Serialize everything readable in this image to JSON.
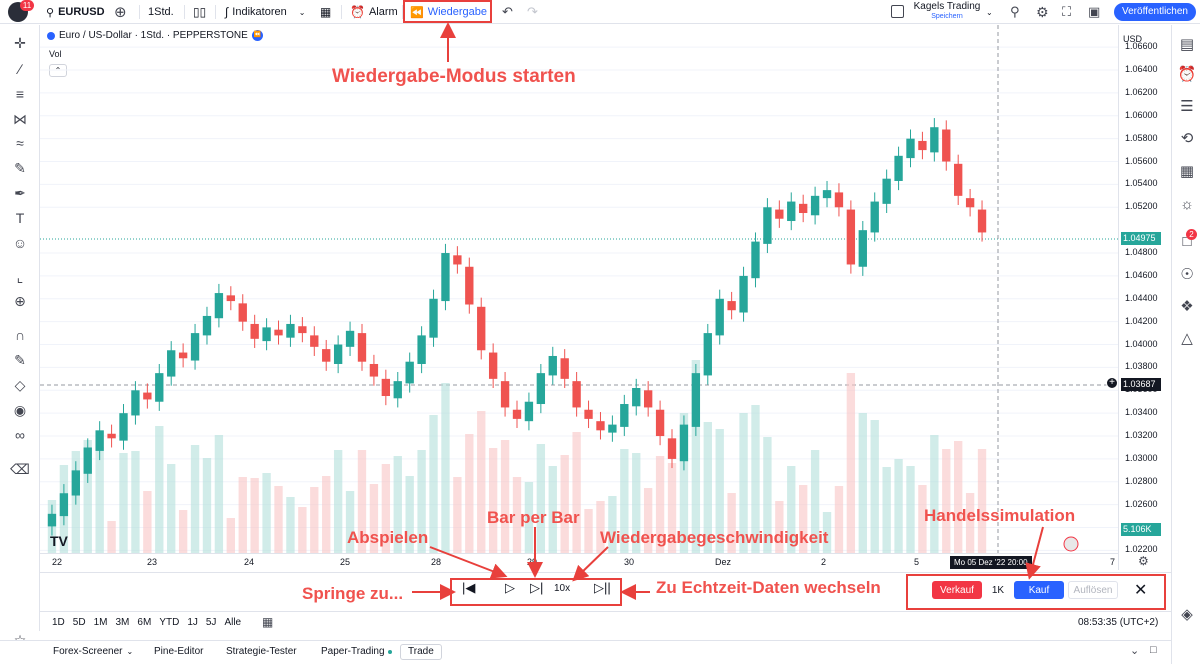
{
  "header": {
    "notification_count": "11",
    "symbol": "EURUSD",
    "interval": "1Std.",
    "indicators_label": "Indikatoren",
    "alarm_label": "Alarm",
    "replay_label": "Wiedergabe",
    "layout_name": "Kagels Trading",
    "layout_sub": "Speichern",
    "publish_label": "Veröffentlichen"
  },
  "legend": {
    "title": "Euro / US-Dollar · 1Std. · PEPPERSTONE",
    "vol_label": "Vol"
  },
  "price_scale": {
    "currency": "USD",
    "labels": [
      "1.06600",
      "1.06400",
      "1.06200",
      "1.06000",
      "1.05800",
      "1.05600",
      "1.05400",
      "1.05200",
      "1.04800",
      "1.04600",
      "1.04400",
      "1.04200",
      "1.04000",
      "1.03800",
      "1.03600",
      "1.03400",
      "1.03200",
      "1.03000",
      "1.02800",
      "1.02600",
      "1.02400",
      "1.02200"
    ],
    "current_price": "1.04975",
    "cursor_price": "1.03687",
    "volume_value": "5.106K"
  },
  "time_axis": {
    "labels": [
      "22",
      "23",
      "24",
      "25",
      "28",
      "29",
      "30",
      "Dez",
      "2",
      "5",
      "7"
    ],
    "cursor_label": "Mo 05 Dez '22   20:00"
  },
  "replay_bar": {
    "speed_label": "10x",
    "sell_label": "Verkauf",
    "qty_label": "1K",
    "buy_label": "Kauf",
    "close_label": "Auflösen"
  },
  "range_bar": {
    "ranges": [
      "1D",
      "5D",
      "1M",
      "3M",
      "6M",
      "YTD",
      "1J",
      "5J",
      "Alle"
    ],
    "clock": "08:53:35 (UTC+2)"
  },
  "bottom_tabs": [
    "Forex-Screener",
    "Pine-Editor",
    "Strategie-Tester",
    "Paper-Trading",
    "Trade"
  ],
  "right_badge": "2",
  "annotations": {
    "replay_start": "Wiedergabe-Modus starten",
    "play": "Abspielen",
    "bar_by_bar": "Bar per Bar",
    "speed": "Wiedergabegeschwindigkeit",
    "jump_to": "Springe zu...",
    "realtime": "Zu Echtzeit-Daten wechseln",
    "trade_sim": "Handelssimulation"
  },
  "colors": {
    "up": "#26a69a",
    "down": "#ef5350",
    "accent": "#2962ff",
    "annotation": "#f0524e"
  },
  "chart_data": {
    "type": "candlestick",
    "title": "Euro / US-Dollar · 1Std. · PEPPERSTONE",
    "ylim": [
      1.0216,
      1.0668
    ],
    "series": [
      {
        "name": "EURUSD",
        "points": [
          [
            1.0241,
            1.0252
          ],
          [
            1.025,
            1.027
          ],
          [
            1.0268,
            1.029
          ],
          [
            1.0287,
            1.031
          ],
          [
            1.0307,
            1.0325
          ],
          [
            1.0322,
            1.0318
          ],
          [
            1.0316,
            1.034
          ],
          [
            1.0338,
            1.036
          ],
          [
            1.0358,
            1.0352
          ],
          [
            1.035,
            1.0375
          ],
          [
            1.0372,
            1.0395
          ],
          [
            1.0393,
            1.0388
          ],
          [
            1.0386,
            1.041
          ],
          [
            1.0408,
            1.0425
          ],
          [
            1.0423,
            1.0445
          ],
          [
            1.0443,
            1.0438
          ],
          [
            1.0436,
            1.042
          ],
          [
            1.0418,
            1.0405
          ],
          [
            1.0403,
            1.0415
          ],
          [
            1.0413,
            1.0408
          ],
          [
            1.0406,
            1.0418
          ],
          [
            1.0416,
            1.041
          ],
          [
            1.0408,
            1.0398
          ],
          [
            1.0396,
            1.0385
          ],
          [
            1.0383,
            1.04
          ],
          [
            1.0398,
            1.0412
          ],
          [
            1.041,
            1.0385
          ],
          [
            1.0383,
            1.0372
          ],
          [
            1.037,
            1.0355
          ],
          [
            1.0353,
            1.0368
          ],
          [
            1.0366,
            1.0385
          ],
          [
            1.0383,
            1.0408
          ],
          [
            1.0406,
            1.044
          ],
          [
            1.0438,
            1.048
          ],
          [
            1.0478,
            1.047
          ],
          [
            1.0468,
            1.0435
          ],
          [
            1.0433,
            1.0395
          ],
          [
            1.0393,
            1.037
          ],
          [
            1.0368,
            1.0345
          ],
          [
            1.0343,
            1.0335
          ],
          [
            1.0333,
            1.035
          ],
          [
            1.0348,
            1.0375
          ],
          [
            1.0373,
            1.039
          ],
          [
            1.0388,
            1.037
          ],
          [
            1.0368,
            1.0345
          ],
          [
            1.0343,
            1.0335
          ],
          [
            1.0333,
            1.0325
          ],
          [
            1.0323,
            1.033
          ],
          [
            1.0328,
            1.0348
          ],
          [
            1.0346,
            1.0362
          ],
          [
            1.036,
            1.0345
          ],
          [
            1.0343,
            1.032
          ],
          [
            1.0318,
            1.03
          ],
          [
            1.0298,
            1.033
          ],
          [
            1.0328,
            1.0375
          ],
          [
            1.0373,
            1.041
          ],
          [
            1.0408,
            1.044
          ],
          [
            1.0438,
            1.043
          ],
          [
            1.0428,
            1.046
          ],
          [
            1.0458,
            1.049
          ],
          [
            1.0488,
            1.052
          ],
          [
            1.0518,
            1.051
          ],
          [
            1.0508,
            1.0525
          ],
          [
            1.0523,
            1.0515
          ],
          [
            1.0513,
            1.053
          ],
          [
            1.0528,
            1.0535
          ],
          [
            1.0533,
            1.052
          ],
          [
            1.0518,
            1.047
          ],
          [
            1.0468,
            1.05
          ],
          [
            1.0498,
            1.0525
          ],
          [
            1.0523,
            1.0545
          ],
          [
            1.0543,
            1.0565
          ],
          [
            1.0563,
            1.058
          ],
          [
            1.0578,
            1.057
          ],
          [
            1.0568,
            1.059
          ],
          [
            1.0588,
            1.056
          ],
          [
            1.0558,
            1.053
          ],
          [
            1.0528,
            1.052
          ],
          [
            1.0518,
            1.0498
          ]
        ]
      }
    ]
  }
}
